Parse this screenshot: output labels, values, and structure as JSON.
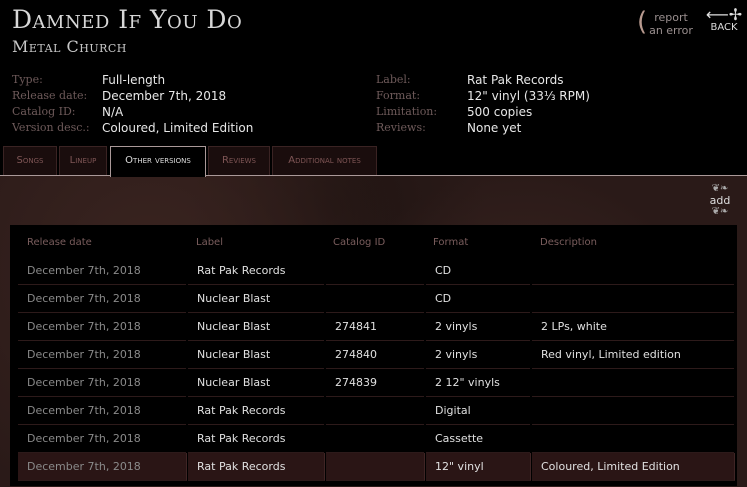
{
  "album": {
    "title": "Damned If You Do",
    "band": "Metal Church"
  },
  "header_actions": {
    "report": "report\nan error",
    "report_line1": "report",
    "report_line2": "an error",
    "back": "BACK"
  },
  "details_left": [
    {
      "label": "Type:",
      "value": "Full-length"
    },
    {
      "label": "Release date:",
      "value": "December 7th, 2018"
    },
    {
      "label": "Catalog ID:",
      "value": "N/A"
    },
    {
      "label": "Version desc.:",
      "value": "Coloured, Limited Edition"
    }
  ],
  "details_right": [
    {
      "label": "Label:",
      "value": "Rat Pak Records"
    },
    {
      "label": "Format:",
      "value": "12\" vinyl (33⅓ RPM)"
    },
    {
      "label": "Limitation:",
      "value": "500 copies"
    },
    {
      "label": "Reviews:",
      "value": "None yet"
    }
  ],
  "tabs": [
    {
      "label": "Songs",
      "active": false
    },
    {
      "label": "Lineup",
      "active": false
    },
    {
      "label": "Other versions",
      "active": true
    },
    {
      "label": "Reviews",
      "active": false
    },
    {
      "label": "Additional notes",
      "active": false
    }
  ],
  "add_label": "add",
  "versions_table": {
    "columns": [
      "Release date",
      "Label",
      "Catalog ID",
      "Format",
      "Description"
    ],
    "rows": [
      [
        "December 7th, 2018",
        "Rat Pak Records",
        "",
        "CD",
        ""
      ],
      [
        "December 7th, 2018",
        "Nuclear Blast",
        "",
        "CD",
        ""
      ],
      [
        "December 7th, 2018",
        "Nuclear Blast",
        "274841",
        "2 vinyls",
        "2 LPs, white"
      ],
      [
        "December 7th, 2018",
        "Nuclear Blast",
        "274840",
        "2 vinyls",
        "Red vinyl, Limited edition"
      ],
      [
        "December 7th, 2018",
        "Nuclear Blast",
        "274839",
        "2 12\" vinyls",
        ""
      ],
      [
        "December 7th, 2018",
        "Rat Pak Records",
        "",
        "Digital",
        ""
      ],
      [
        "December 7th, 2018",
        "Rat Pak Records",
        "",
        "Cassette",
        ""
      ],
      [
        "December 7th, 2018",
        "Rat Pak Records",
        "",
        "12\" vinyl",
        "Coloured, Limited Edition"
      ]
    ],
    "selected_row": 7
  }
}
